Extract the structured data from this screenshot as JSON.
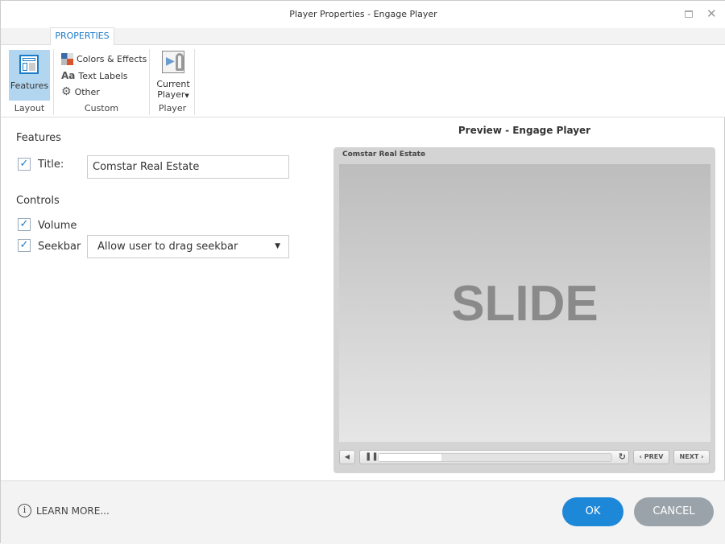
{
  "window": {
    "title": "Player Properties - Engage Player"
  },
  "ribbon": {
    "tab": "PROPERTIES",
    "groups": [
      {
        "label": "Layout",
        "items": [
          "Features"
        ]
      },
      {
        "label": "Custom",
        "items": [
          "Colors & Effects",
          "Text Labels",
          "Other"
        ]
      },
      {
        "label": "Player",
        "items": [
          "Current Player"
        ]
      }
    ],
    "text_labels_icon": "Aa",
    "current_player_line1": "Current",
    "current_player_line2": "Player"
  },
  "features": {
    "heading": "Features",
    "title_label": "Title:",
    "title_value": "Comstar Real Estate",
    "title_checked": true,
    "controls_heading": "Controls",
    "volume_label": "Volume",
    "volume_checked": true,
    "seekbar_label": "Seekbar",
    "seekbar_checked": true,
    "seekbar_option": "Allow user to drag seekbar"
  },
  "preview": {
    "heading": "Preview - Engage Player",
    "player_title": "Comstar Real Estate",
    "slide_text": "SLIDE",
    "progress_percent": 27,
    "prev": "PREV",
    "next": "NEXT"
  },
  "footer": {
    "learn_more": "LEARN MORE...",
    "ok": "OK",
    "cancel": "CANCEL"
  },
  "colors": {
    "accent": "#1a7bc9",
    "ok": "#1e88d8",
    "cancel": "#9aa3aa"
  }
}
